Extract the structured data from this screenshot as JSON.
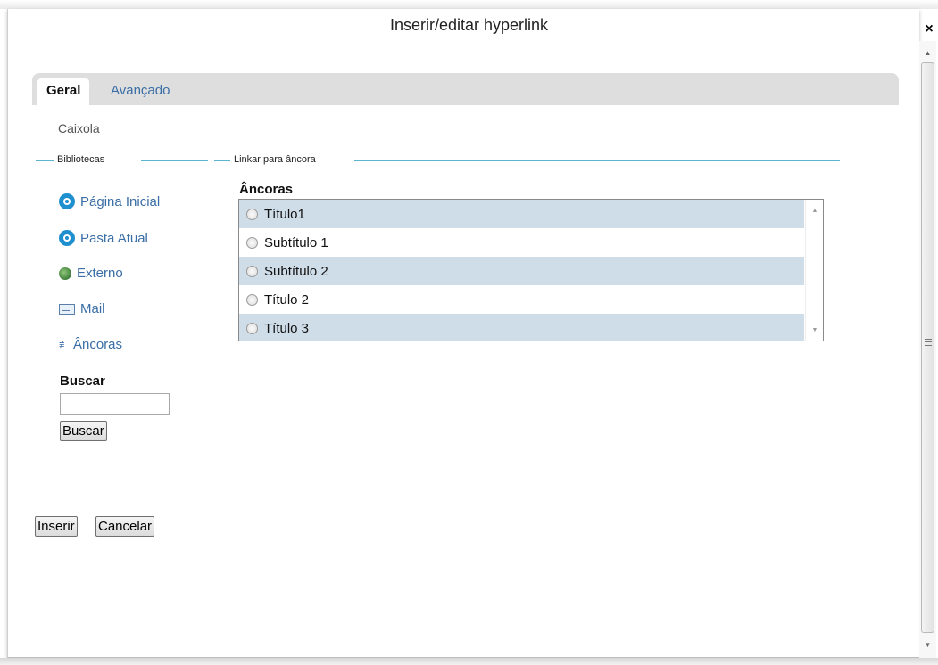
{
  "dialog": {
    "title": "Inserir/editar hyperlink",
    "close_symbol": "×"
  },
  "tabs": [
    {
      "label": "Geral",
      "active": true
    },
    {
      "label": "Avançado",
      "active": false
    }
  ],
  "breadcrumb": "Caixola",
  "libraries": {
    "legend": "Bibliotecas",
    "items": [
      {
        "label": "Página Inicial",
        "icon": "home-icon"
      },
      {
        "label": "Pasta Atual",
        "icon": "folder-icon"
      },
      {
        "label": "Externo",
        "icon": "globe-icon"
      },
      {
        "label": "Mail",
        "icon": "mail-icon"
      },
      {
        "label": "Âncoras",
        "icon": "anchor-icon"
      }
    ],
    "search_label": "Buscar",
    "search_value": "",
    "search_button": "Buscar"
  },
  "anchor_panel": {
    "legend": "Linkar para âncora",
    "heading": "Âncoras",
    "anchors": [
      "Título1",
      "Subtítulo 1",
      "Subtítulo 2",
      "Título 2",
      "Título 3"
    ]
  },
  "footer": {
    "insert_button": "Inserir",
    "cancel_button": "Cancelar"
  },
  "colors": {
    "link": "#3a6ea5",
    "row_shade": "#cfdde9",
    "legend_line": "#5db4cf"
  }
}
